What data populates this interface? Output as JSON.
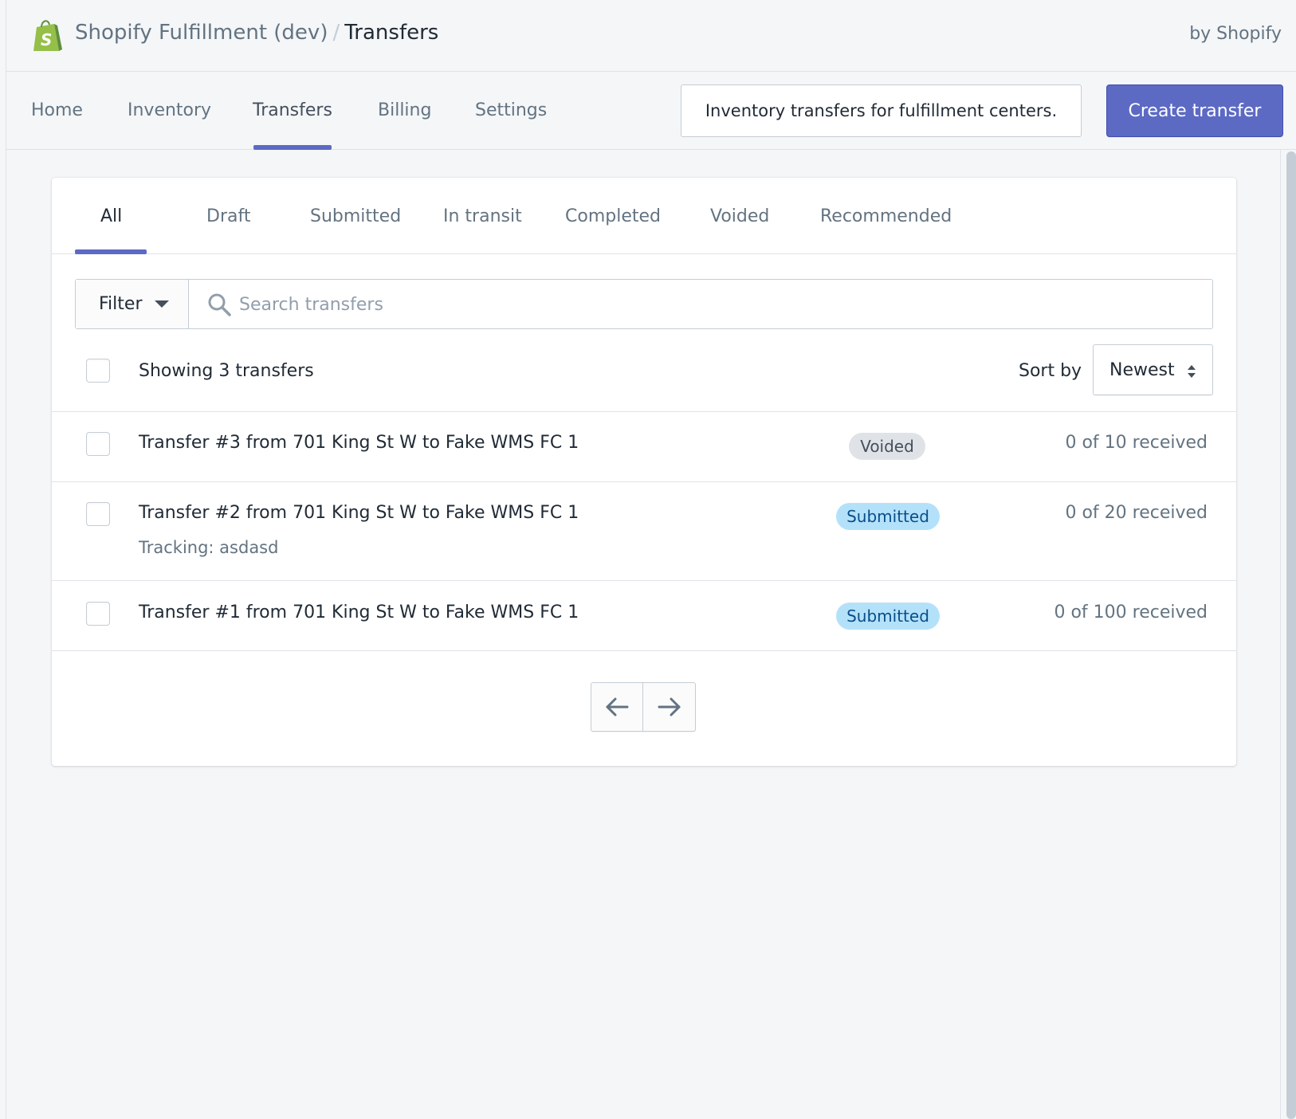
{
  "header": {
    "app_name": "Shopify Fulfillment (dev)",
    "separator": "/",
    "current_page": "Transfers",
    "byline": "by Shopify"
  },
  "nav": {
    "items": [
      {
        "label": "Home",
        "active": false
      },
      {
        "label": "Inventory",
        "active": false
      },
      {
        "label": "Transfers",
        "active": true
      },
      {
        "label": "Billing",
        "active": false
      },
      {
        "label": "Settings",
        "active": false
      }
    ],
    "info_text": "Inventory transfers for fulfillment centers.",
    "primary_action": "Create transfer"
  },
  "tabs": [
    {
      "label": "All",
      "active": true
    },
    {
      "label": "Draft",
      "active": false
    },
    {
      "label": "Submitted",
      "active": false
    },
    {
      "label": "In transit",
      "active": false
    },
    {
      "label": "Completed",
      "active": false
    },
    {
      "label": "Voided",
      "active": false
    },
    {
      "label": "Recommended",
      "active": false
    }
  ],
  "filter": {
    "button_label": "Filter",
    "search_placeholder": "Search transfers",
    "search_value": ""
  },
  "list_header": {
    "showing": "Showing 3 transfers",
    "sort_label": "Sort by",
    "sort_value": "Newest"
  },
  "transfers": [
    {
      "title": "Transfer #3 from 701 King St W to Fake WMS FC 1",
      "status": "Voided",
      "status_kind": "voided",
      "received": "0 of 10 received",
      "tracking": ""
    },
    {
      "title": "Transfer #2 from 701 King St W to Fake WMS FC 1",
      "status": "Submitted",
      "status_kind": "submitted",
      "received": "0 of 20 received",
      "tracking": "Tracking: asdasd"
    },
    {
      "title": "Transfer #1 from 701 King St W to Fake WMS FC 1",
      "status": "Submitted",
      "status_kind": "submitted",
      "received": "0 of 100 received",
      "tracking": ""
    }
  ],
  "pagination": {
    "prev_icon": "arrow-left-icon",
    "next_icon": "arrow-right-icon"
  },
  "colors": {
    "accent": "#5c6ac4",
    "background": "#f4f6f8",
    "badge_submitted_bg": "#b4e1fa",
    "badge_voided_bg": "#dfe3e8",
    "logo_green": "#95bf47"
  }
}
